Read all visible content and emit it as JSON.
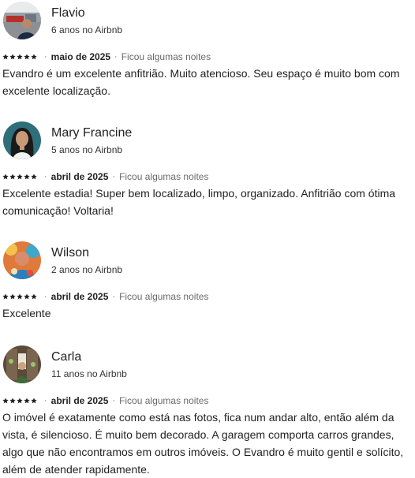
{
  "reviews": [
    {
      "name": "Flavio",
      "tenure": "6 anos no Airbnb",
      "rating": 5,
      "date": "maio de 2025",
      "stay": "Ficou algumas noites",
      "text": "Evandro é um excelente anfitrião. Muito atencioso. Seu espaço é muito bom com excelente localização."
    },
    {
      "name": "Mary Francine",
      "tenure": "5 anos no Airbnb",
      "rating": 5,
      "date": "abril de 2025",
      "stay": "Ficou algumas noites",
      "text": "Excelente estadia! Super bem localizado, limpo, organizado. Anfitrião com ótima comunicação! Voltaria!"
    },
    {
      "name": "Wilson",
      "tenure": "2 anos no Airbnb",
      "rating": 5,
      "date": "abril de 2025",
      "stay": "Ficou algumas noites",
      "text": "Excelente"
    },
    {
      "name": "Carla",
      "tenure": "11 anos no Airbnb",
      "rating": 5,
      "date": "abril de 2025",
      "stay": "Ficou algumas noites",
      "text": "O imóvel é exatamente como está nas fotos, fica num andar alto, então além da vista, é silencioso. É muito bem decorado. A garagem comporta carros grandes, algo que não encontramos em outros imóveis. O Evandro é muito gentil e solícito, além de atender rapidamente."
    }
  ],
  "icons": {
    "star": "star-icon",
    "avatar": "avatar"
  },
  "colors": {
    "text": "#222222",
    "muted": "#6a6a6a",
    "star": "#222222"
  }
}
